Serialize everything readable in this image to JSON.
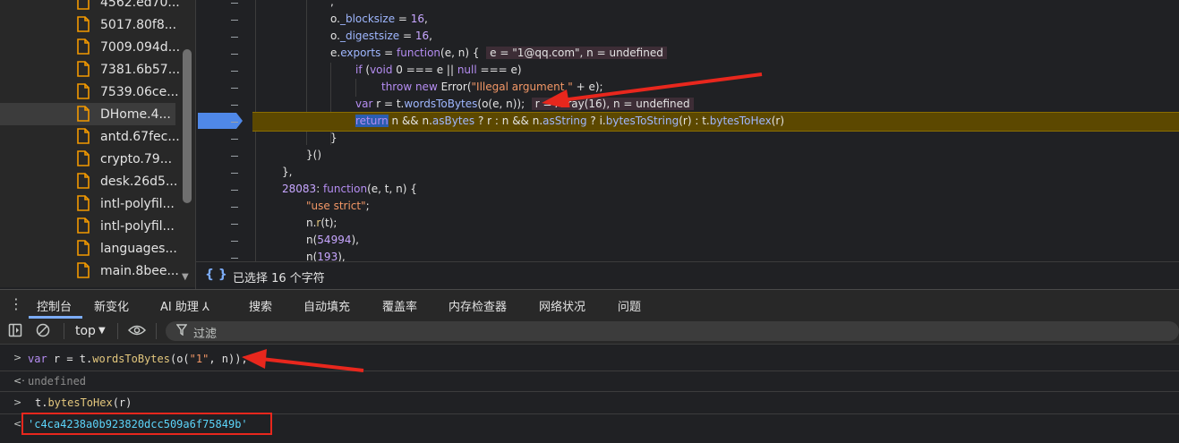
{
  "file_tree": {
    "files": [
      "4562.ed70...",
      "5017.80f8...",
      "7009.094d...",
      "7381.6b57...",
      "7539.06ce...",
      "DHome.4...",
      "antd.67fec...",
      "crypto.79...",
      "desk.26d5...",
      "intl-polyfil...",
      "intl-polyfil...",
      "languages...",
      "main.8bee..."
    ],
    "selected_index": 5
  },
  "editor": {
    "lines": [
      {
        "html_id": "l0",
        "text": ","
      },
      {
        "html_id": "l1",
        "obj": "o",
        "prop": "_blocksize",
        "rest": " = ",
        "num": "16",
        "end": ","
      },
      {
        "html_id": "l2",
        "obj": "o",
        "prop": "_digestsize",
        "rest": " = ",
        "num": "16",
        "end": ","
      },
      {
        "html_id": "l3"
      },
      {
        "html_id": "l4"
      },
      {
        "html_id": "l5"
      },
      {
        "html_id": "l6"
      },
      {
        "html_id": "l7"
      },
      {
        "html_id": "l8",
        "text": "}"
      },
      {
        "html_id": "l9",
        "text": "}()"
      },
      {
        "html_id": "l10",
        "text": "},"
      },
      {
        "html_id": "l11"
      },
      {
        "html_id": "l12"
      },
      {
        "html_id": "l13"
      },
      {
        "html_id": "l14"
      },
      {
        "html_id": "l15"
      }
    ],
    "inline_values": {
      "line3": "e = \"1@qq.com\", n = undefined",
      "line6": "r = Array(16), n = undefined"
    },
    "code": {
      "line3_a": "e.",
      "line3_b": "exports",
      "line3_c": " = ",
      "line3_d": "function",
      "line3_e": "(e, n) {",
      "line4_a": "if",
      "line4_b": " (",
      "line4_c": "void",
      "line4_d": " 0 === e || ",
      "line4_e": "null",
      "line4_f": " === e)",
      "line5_a": "throw new",
      "line5_b": " Error(",
      "line5_c": "\"Illegal argument \"",
      "line5_d": " + e);",
      "line6_a": "var",
      "line6_b": " r = t.",
      "line6_c": "wordsToBytes",
      "line6_d": "(o(e, n));",
      "line7_a": "return",
      "line7_b": " n && n.",
      "line7_c": "asBytes",
      "line7_d": " ? r : n && n.",
      "line7_e": "asString",
      "line7_f": " ? i.",
      "line7_g": "bytesToString",
      "line7_h": "(r) : t.",
      "line7_i": "bytesToHex",
      "line7_j": "(r)",
      "line11_a": "28083",
      "line11_b": ": ",
      "line11_c": "function",
      "line11_d": "(e, t, n) {",
      "line12_a": "\"use strict\"",
      "line12_b": ";",
      "line13_a": "n.",
      "line13_b": "r",
      "line13_c": "(t);",
      "line14_a": "n(",
      "line14_b": "54994",
      "line14_c": "),",
      "line15_a": "n(",
      "line15_b": "193",
      "line15_c": "),"
    }
  },
  "editor_status": {
    "braces": "{ }",
    "text": "已选择 16 个字符"
  },
  "drawer": {
    "menu_icon": "⋮",
    "tabs": [
      "控制台",
      "新变化",
      "AI 助理 ⅄",
      "搜索",
      "自动填充",
      "覆盖率",
      "内存检查器",
      "网络状况",
      "问题"
    ],
    "active_tab": 0
  },
  "console_toolbar": {
    "context": "top",
    "filter_placeholder": "过滤"
  },
  "console": {
    "in1_kw": "var",
    "in1_a": " r = t.",
    "in1_fn": "wordsToBytes",
    "in1_b": "(o(",
    "in1_str": "\"1\"",
    "in1_c": ", n));",
    "out1": "undefined",
    "in2_a": "t.",
    "in2_fn": "bytesToHex",
    "in2_b": "(r)",
    "out2": "'c4ca4238a0b923820dcc509a6f75849b'"
  },
  "colors": {
    "annotation_red": "#e8271d",
    "accent_blue": "#7cacf8",
    "exec_highlight": "#5c4800"
  }
}
